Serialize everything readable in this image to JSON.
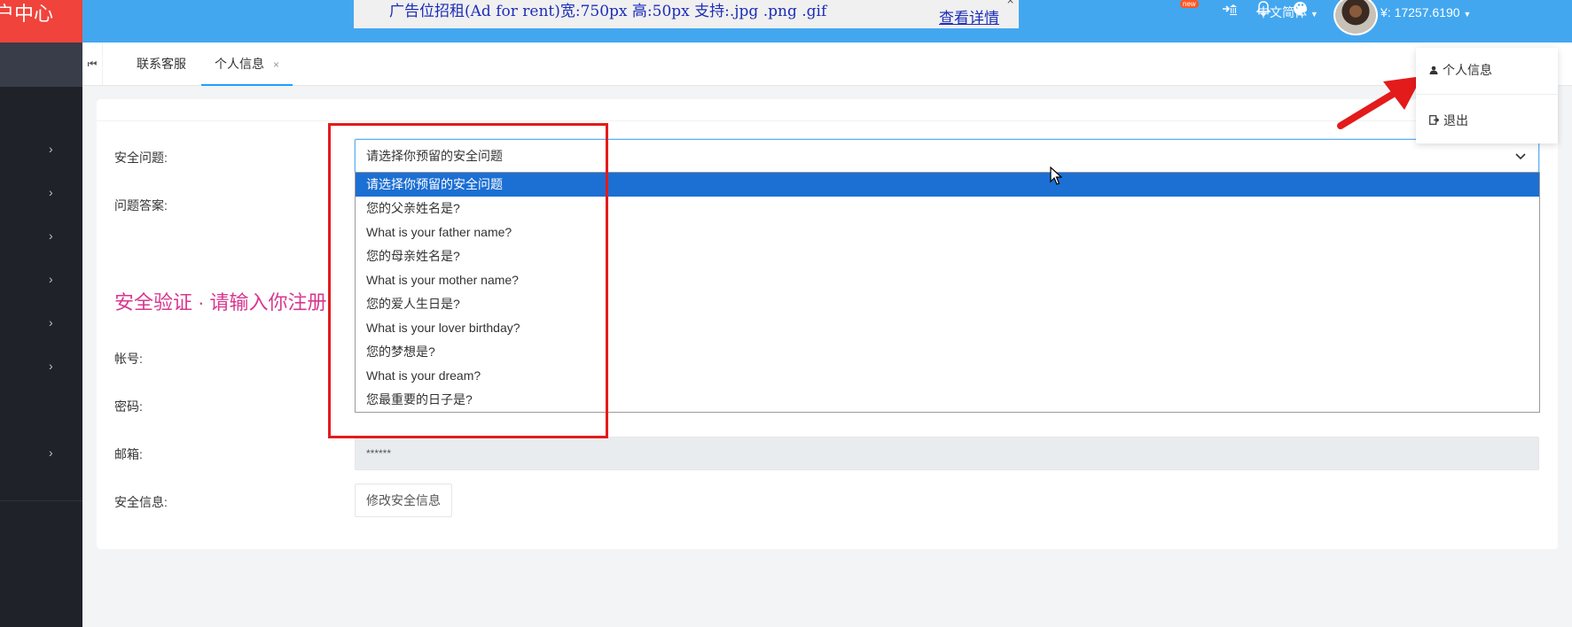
{
  "brand": {
    "logo_text": "户中心",
    "color": "#f0433b"
  },
  "sidebar": {
    "chevrons": [
      "›",
      "›",
      "›",
      "›",
      "›",
      "›",
      "›"
    ]
  },
  "header": {
    "ad_text": "广告位招租(Ad for rent)宽:750px 高:50px 支持:.jpg .png .gif",
    "ad_link": "查看详情",
    "ad_close": "×",
    "icons": [
      "logout-bank-icon",
      "bell-icon",
      "palette-icon"
    ],
    "new_badge": "new",
    "language": "中文简体",
    "balance": "¥:  17257.6190",
    "accent": "#43a7f0"
  },
  "tabs": {
    "nav_icon": "⏮",
    "items": [
      {
        "label": "联系客服"
      },
      {
        "label": "个人信息",
        "active": true,
        "close": "×"
      }
    ]
  },
  "form": {
    "security_question_label": "安全问题:",
    "answer_label": "问题答案:",
    "heading": "安全验证 · 请输入你注册",
    "account_label": "帐号:",
    "password_label": "密码:",
    "email_label": "邮箱:",
    "email_value": "******",
    "security_info_label": "安全信息:",
    "modify_button": "修改安全信息",
    "select_value": "请选择你预留的安全问题",
    "select_chevron": "⌄"
  },
  "dropdown": {
    "options": [
      "请选择你预留的安全问题",
      "您的父亲姓名是?",
      "What is your father name?",
      "您的母亲姓名是?",
      "What is your mother name?",
      "您的爱人生日是?",
      "What is your lover birthday?",
      "您的梦想是?",
      "What is your dream?",
      "您最重要的日子是?"
    ],
    "selected_index": 0,
    "highlight_color": "#1c6fd3"
  },
  "user_menu": {
    "items": [
      {
        "icon": "user-icon",
        "glyph": "👤",
        "label": "个人信息"
      },
      {
        "icon": "logout-icon",
        "glyph": "⇥",
        "label": "退出"
      }
    ]
  },
  "annotation_color": "#e31b1b"
}
